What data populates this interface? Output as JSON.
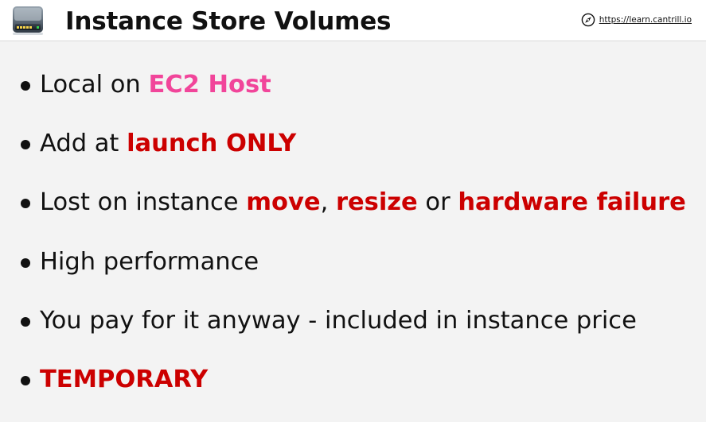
{
  "header": {
    "title": "Instance Store Volumes",
    "link_text": "https://learn.cantrill.io",
    "icons": {
      "left": "hard-drive-icon",
      "link": "compass-icon"
    }
  },
  "colors": {
    "highlight_pink": "#f1459a",
    "highlight_red": "#cc0000",
    "text": "#111111",
    "background": "#f3f3f3"
  },
  "bullets": [
    {
      "parts": [
        {
          "text": "Local on ",
          "style": "normal"
        },
        {
          "text": "EC2 Host",
          "style": "pink"
        }
      ]
    },
    {
      "parts": [
        {
          "text": "Add at ",
          "style": "normal"
        },
        {
          "text": "launch ONLY",
          "style": "red"
        }
      ]
    },
    {
      "parts": [
        {
          "text": "Lost on instance ",
          "style": "normal"
        },
        {
          "text": "move",
          "style": "red"
        },
        {
          "text": ", ",
          "style": "normal"
        },
        {
          "text": "resize",
          "style": "red"
        },
        {
          "text": " or ",
          "style": "normal"
        },
        {
          "text": "hardware failure",
          "style": "red"
        }
      ]
    },
    {
      "parts": [
        {
          "text": "High performance",
          "style": "normal"
        }
      ]
    },
    {
      "parts": [
        {
          "text": "You pay for it anyway - included in instance price",
          "style": "normal"
        }
      ]
    },
    {
      "parts": [
        {
          "text": "TEMPORARY",
          "style": "red"
        }
      ]
    }
  ]
}
